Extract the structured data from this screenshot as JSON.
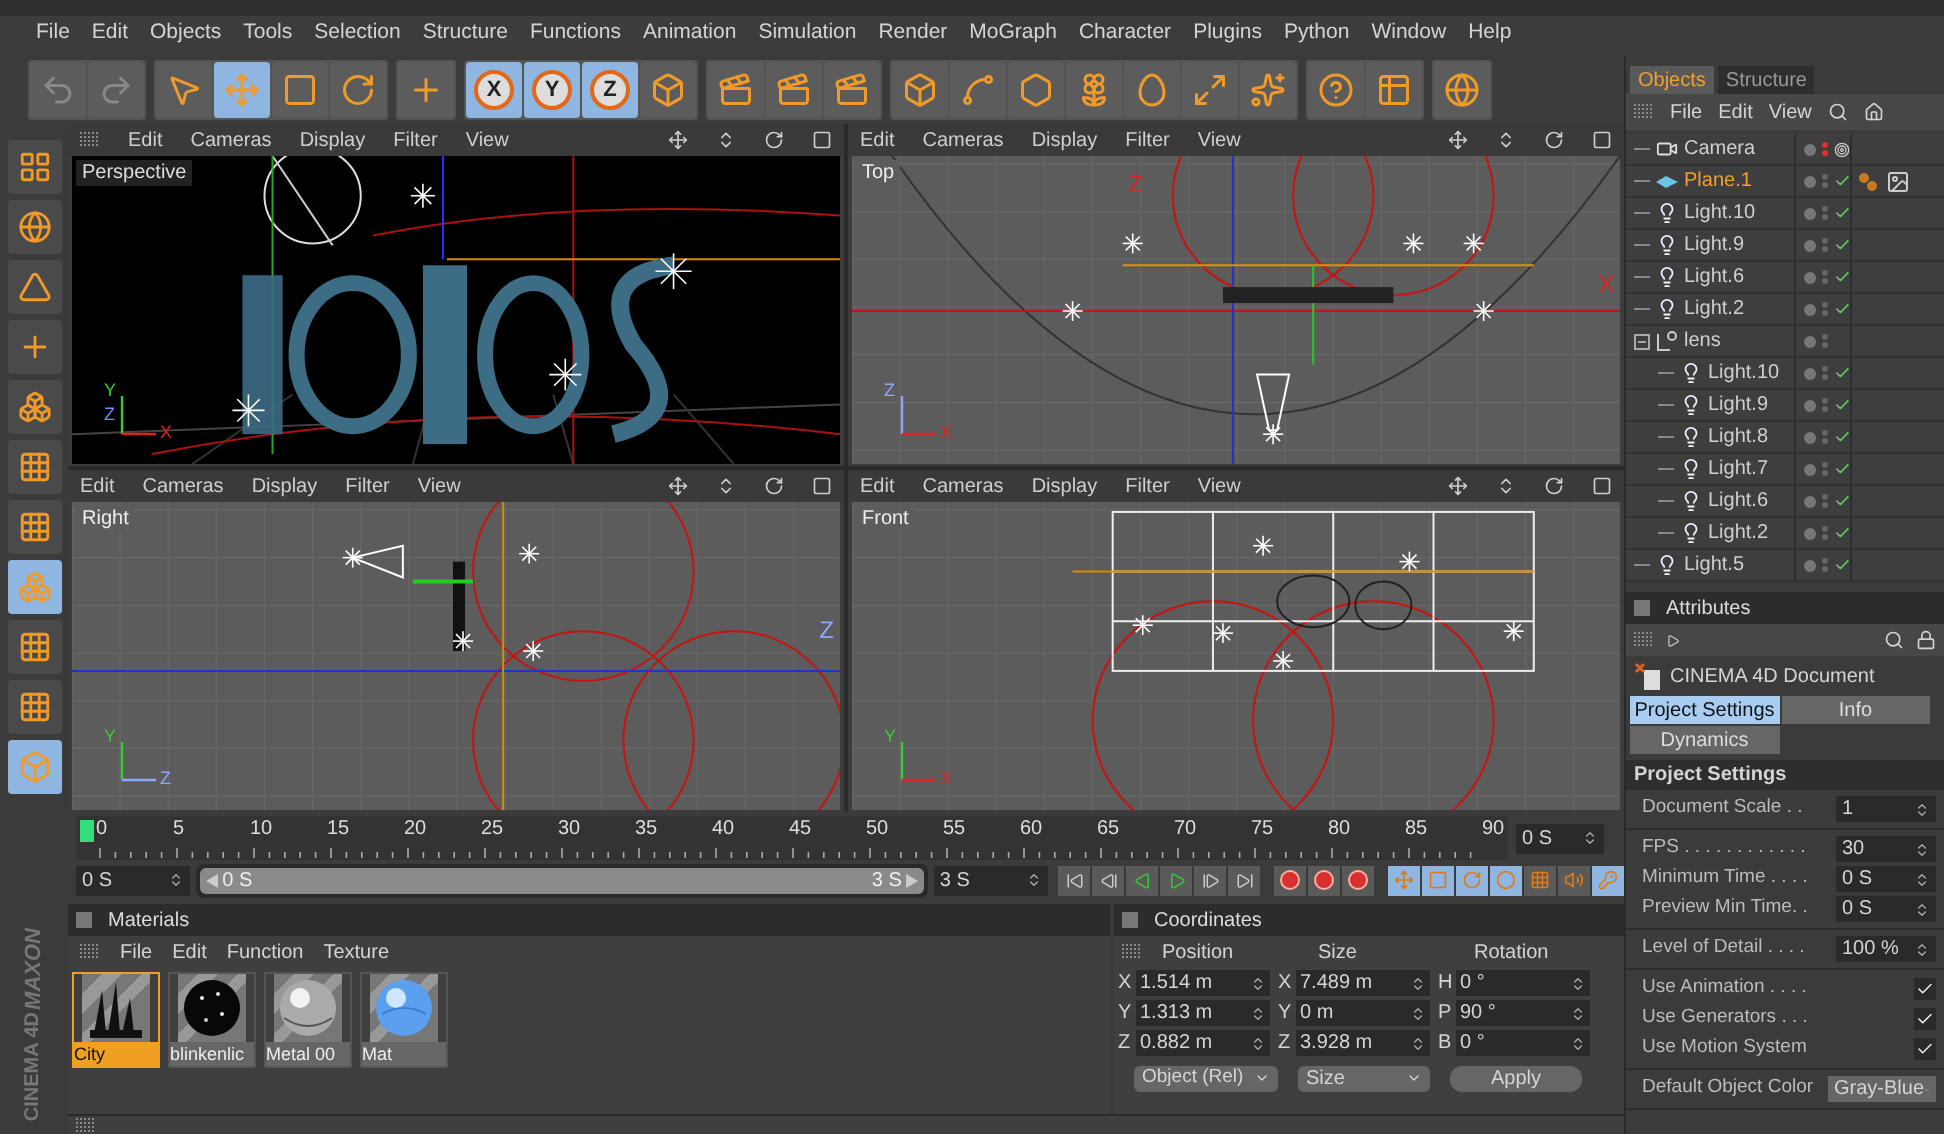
{
  "menu": [
    "File",
    "Edit",
    "Objects",
    "Tools",
    "Selection",
    "Structure",
    "Functions",
    "Animation",
    "Simulation",
    "Render",
    "MoGraph",
    "Character",
    "Plugins",
    "Python",
    "Window",
    "Help"
  ],
  "toolbar": [
    [
      {
        "kind": "undo",
        "selected": false
      },
      {
        "kind": "redo",
        "selected": false
      }
    ],
    [
      {
        "kind": "select",
        "selected": false
      },
      {
        "kind": "move",
        "selected": true
      },
      {
        "kind": "scale",
        "selected": false
      },
      {
        "kind": "rotate",
        "selected": false
      }
    ],
    [
      {
        "kind": "axis",
        "selected": false
      }
    ],
    [
      {
        "kind": "lock",
        "label": "X",
        "selected": true
      },
      {
        "kind": "lock",
        "label": "Y",
        "selected": true
      },
      {
        "kind": "lock",
        "label": "Z",
        "selected": true
      },
      {
        "kind": "coords",
        "selected": false
      }
    ],
    [
      {
        "kind": "render",
        "selected": false
      },
      {
        "kind": "render",
        "selected": false
      },
      {
        "kind": "render-settings",
        "selected": false
      }
    ],
    [
      {
        "kind": "cube",
        "selected": false
      },
      {
        "kind": "spline",
        "selected": false
      },
      {
        "kind": "nurbs",
        "selected": false
      },
      {
        "kind": "array",
        "selected": false
      },
      {
        "kind": "deformer",
        "selected": false
      },
      {
        "kind": "scene",
        "selected": false
      },
      {
        "kind": "particles",
        "selected": false
      }
    ],
    [
      {
        "kind": "help",
        "selected": false
      },
      {
        "kind": "script",
        "selected": false
      }
    ],
    [
      {
        "kind": "web",
        "selected": false
      }
    ]
  ],
  "left_tools": [
    {
      "kind": "layout",
      "selected": false
    },
    {
      "kind": "globe",
      "selected": false
    },
    {
      "kind": "model",
      "selected": false
    },
    {
      "kind": "axis",
      "selected": false
    },
    {
      "kind": "texture",
      "selected": false
    },
    {
      "kind": "grid",
      "selected": false
    },
    {
      "kind": "points",
      "selected": false
    },
    {
      "kind": "polygons",
      "selected": true
    },
    {
      "kind": "checker",
      "selected": false
    },
    {
      "kind": "checker",
      "selected": false
    },
    {
      "kind": "snap",
      "selected": true
    }
  ],
  "viewports": [
    {
      "kind": "perspective",
      "label": "Perspective",
      "menu": [
        "Edit",
        "Cameras",
        "Display",
        "Filter",
        "View"
      ],
      "axes": [
        {
          "label": "Y",
          "kind": "up",
          "color": "#33cc33"
        },
        {
          "label": "Z",
          "kind": "mid",
          "color": "#6f8cff"
        },
        {
          "label": "X",
          "kind": "right",
          "color": "#dd2222"
        }
      ]
    },
    {
      "kind": "top",
      "label": "Top",
      "menu": [
        "Edit",
        "Cameras",
        "Display",
        "Filter",
        "View"
      ],
      "axes": [
        {
          "label": "Z",
          "kind": "up",
          "color": "#8fa6ff"
        },
        {
          "label": "X",
          "kind": "right",
          "color": "#dd2222"
        }
      ],
      "line_labels": [
        {
          "label": "Z",
          "kind": "top",
          "color": "#dd2222"
        },
        {
          "label": "X",
          "kind": "right",
          "color": "#dd2222"
        }
      ]
    },
    {
      "kind": "right",
      "label": "Right",
      "menu": [
        "Edit",
        "Cameras",
        "Display",
        "Filter",
        "View"
      ],
      "axes": [
        {
          "label": "Y",
          "kind": "up",
          "color": "#33cc33"
        },
        {
          "label": "Z",
          "kind": "right",
          "color": "#8fa6ff"
        }
      ],
      "line_labels": [
        {
          "label": "Z",
          "kind": "right",
          "color": "#8fa6ff"
        }
      ]
    },
    {
      "kind": "front",
      "label": "Front",
      "menu": [
        "Edit",
        "Cameras",
        "Display",
        "Filter",
        "View"
      ],
      "axes": [
        {
          "label": "Y",
          "kind": "up",
          "color": "#33cc33"
        },
        {
          "label": "X",
          "kind": "right",
          "color": "#dd2222"
        }
      ]
    }
  ],
  "objects": {
    "tabs": [
      {
        "label": "Objects",
        "selected": true
      },
      {
        "label": "Structure",
        "selected": false
      }
    ],
    "menu": [
      "File",
      "Edit",
      "View"
    ],
    "tree": [
      {
        "name": "Camera",
        "kind": "camera",
        "selected": false,
        "checked": false,
        "expanded": false
      },
      {
        "name": "Plane.1",
        "kind": "plane",
        "selected": true,
        "checked": true,
        "expanded": false
      },
      {
        "name": "Light.10",
        "kind": "light",
        "selected": false,
        "checked": true,
        "expanded": false
      },
      {
        "name": "Light.9",
        "kind": "light",
        "selected": false,
        "checked": true,
        "expanded": false
      },
      {
        "name": "Light.6",
        "kind": "light",
        "selected": false,
        "checked": true,
        "expanded": false
      },
      {
        "name": "Light.2",
        "kind": "light",
        "selected": false,
        "checked": true,
        "expanded": false
      },
      {
        "name": "lens",
        "kind": "null",
        "selected": false,
        "checked": false,
        "expanded": true,
        "children": [
          {
            "name": "Light.10",
            "kind": "light",
            "selected": false,
            "checked": true,
            "expanded": false
          },
          {
            "name": "Light.9",
            "kind": "light",
            "selected": false,
            "checked": true,
            "expanded": false
          },
          {
            "name": "Light.8",
            "kind": "light",
            "selected": false,
            "checked": true,
            "expanded": false
          },
          {
            "name": "Light.7",
            "kind": "light",
            "selected": false,
            "checked": true,
            "expanded": false
          },
          {
            "name": "Light.6",
            "kind": "light",
            "selected": false,
            "checked": true,
            "expanded": false
          },
          {
            "name": "Light.2",
            "kind": "light",
            "selected": false,
            "checked": true,
            "expanded": false
          }
        ]
      },
      {
        "name": "Light.5",
        "kind": "light",
        "selected": false,
        "checked": true,
        "expanded": false
      }
    ]
  },
  "attributes": {
    "title": "Attributes",
    "document": "CINEMA 4D Document",
    "tabs": [
      {
        "label": "Project Settings",
        "selected": true
      },
      {
        "label": "Info",
        "selected": false
      },
      {
        "label": "Dynamics",
        "selected": false
      }
    ],
    "section": "Project Settings",
    "groups": [
      [
        {
          "kind": "number",
          "label": "Document Scale . .",
          "value": "1"
        }
      ],
      [
        {
          "kind": "number",
          "label": "FPS . . . . . . . . . . . .",
          "value": "30"
        },
        {
          "kind": "number",
          "label": "Minimum Time . . . .",
          "value": "0 S"
        },
        {
          "kind": "number",
          "label": "Preview Min Time. .",
          "value": "0 S"
        }
      ],
      [
        {
          "kind": "number",
          "label": "Level of Detail . . . .",
          "value": "100 %"
        }
      ],
      [
        {
          "kind": "check",
          "label": "Use Animation . . . .",
          "checked": true
        },
        {
          "kind": "check",
          "label": "Use Generators . . .",
          "checked": true
        },
        {
          "kind": "check",
          "label": "Use Motion System",
          "checked": true
        }
      ],
      [
        {
          "kind": "dropdown",
          "label": "Default Object Color",
          "value": "Gray-Blue"
        }
      ]
    ]
  },
  "timeline": {
    "ticks": [
      "0",
      "5",
      "10",
      "15",
      "20",
      "25",
      "30",
      "35",
      "40",
      "45",
      "50",
      "55",
      "60",
      "65",
      "70",
      "75",
      "80",
      "85",
      "90"
    ],
    "frame": "0 S",
    "start": "0 S",
    "range_start": "0 S",
    "range_end": "3 S",
    "range": {
      "level": 1
    },
    "end": "3 S",
    "key_tools": [
      {
        "kind": "move",
        "selected": true
      },
      {
        "kind": "scale",
        "selected": true
      },
      {
        "kind": "rotate",
        "selected": true
      },
      {
        "kind": "param",
        "selected": true
      },
      {
        "kind": "points",
        "selected": false
      },
      {
        "kind": "sound",
        "selected": false
      },
      {
        "kind": "auto",
        "selected": true
      }
    ]
  },
  "materials": {
    "title": "Materials",
    "menu": [
      "File",
      "Edit",
      "Function",
      "Texture"
    ],
    "items": [
      {
        "name": "City",
        "selected": true
      },
      {
        "name": "blinkenlic",
        "selected": false
      },
      {
        "name": "Metal 00",
        "selected": false
      },
      {
        "name": "Mat",
        "selected": false
      }
    ]
  },
  "coordinates": {
    "title": "Coordinates",
    "columns": [
      {
        "label": "Position",
        "rows": [
          {
            "axis": "X",
            "value": "1.514 m"
          },
          {
            "axis": "Y",
            "value": "1.313 m"
          },
          {
            "axis": "Z",
            "value": "0.882 m"
          }
        ]
      },
      {
        "label": "Size",
        "rows": [
          {
            "axis": "X",
            "value": "7.489 m"
          },
          {
            "axis": "Y",
            "value": "0 m"
          },
          {
            "axis": "Z",
            "value": "3.928 m"
          }
        ]
      },
      {
        "label": "Rotation",
        "rows": [
          {
            "axis": "H",
            "value": "0 °"
          },
          {
            "axis": "P",
            "value": "90 °"
          },
          {
            "axis": "B",
            "value": "0 °"
          }
        ]
      }
    ],
    "mode": "Object (Rel)",
    "size_mode": "Size",
    "apply": "Apply"
  },
  "brand": [
    "MAXON",
    "CINEMA 4D"
  ]
}
